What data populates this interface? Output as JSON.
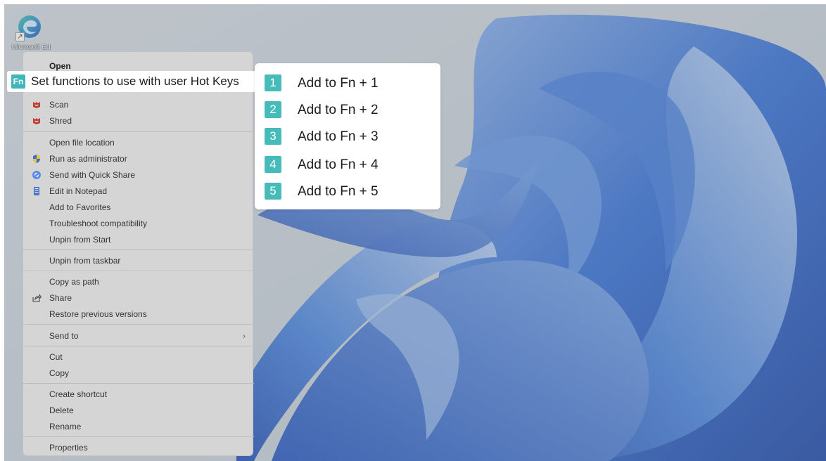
{
  "desktop": {
    "icon_label": "Microsoft Edge"
  },
  "context_menu": {
    "open": "Open",
    "hotkeys": "Set functions to use with user Hot Keys",
    "fn_badge": "Fn",
    "scan": "Scan",
    "shred": "Shred",
    "open_file_location": "Open file location",
    "run_as_admin": "Run as administrator",
    "send_quick_share": "Send with Quick Share",
    "edit_notepad": "Edit in Notepad",
    "add_favorites": "Add to Favorites",
    "troubleshoot": "Troubleshoot compatibility",
    "unpin_start": "Unpin from Start",
    "unpin_taskbar": "Unpin from taskbar",
    "copy_path": "Copy as path",
    "share": "Share",
    "restore_versions": "Restore previous versions",
    "send_to": "Send to",
    "send_to_arrow": "›",
    "cut": "Cut",
    "copy": "Copy",
    "create_shortcut": "Create shortcut",
    "delete": "Delete",
    "rename": "Rename",
    "properties": "Properties"
  },
  "submenu": {
    "items": [
      {
        "num": "1",
        "label": "Add to Fn + 1"
      },
      {
        "num": "2",
        "label": "Add to Fn + 2"
      },
      {
        "num": "3",
        "label": "Add to Fn + 3"
      },
      {
        "num": "4",
        "label": "Add to Fn + 4"
      },
      {
        "num": "5",
        "label": "Add to Fn + 5"
      }
    ]
  },
  "colors": {
    "badge": "#45bcb9",
    "wallpaper_blue": "#2f6fd6",
    "menu_bg": "#d5d5d5"
  },
  "icons": {
    "desktop": "edge-icon",
    "scan": "mcafee-icon",
    "shred": "mcafee-icon",
    "run_as_admin": "shield-icon",
    "quick_share": "quick-share-icon",
    "notepad": "notepad-icon",
    "share": "share-icon"
  }
}
